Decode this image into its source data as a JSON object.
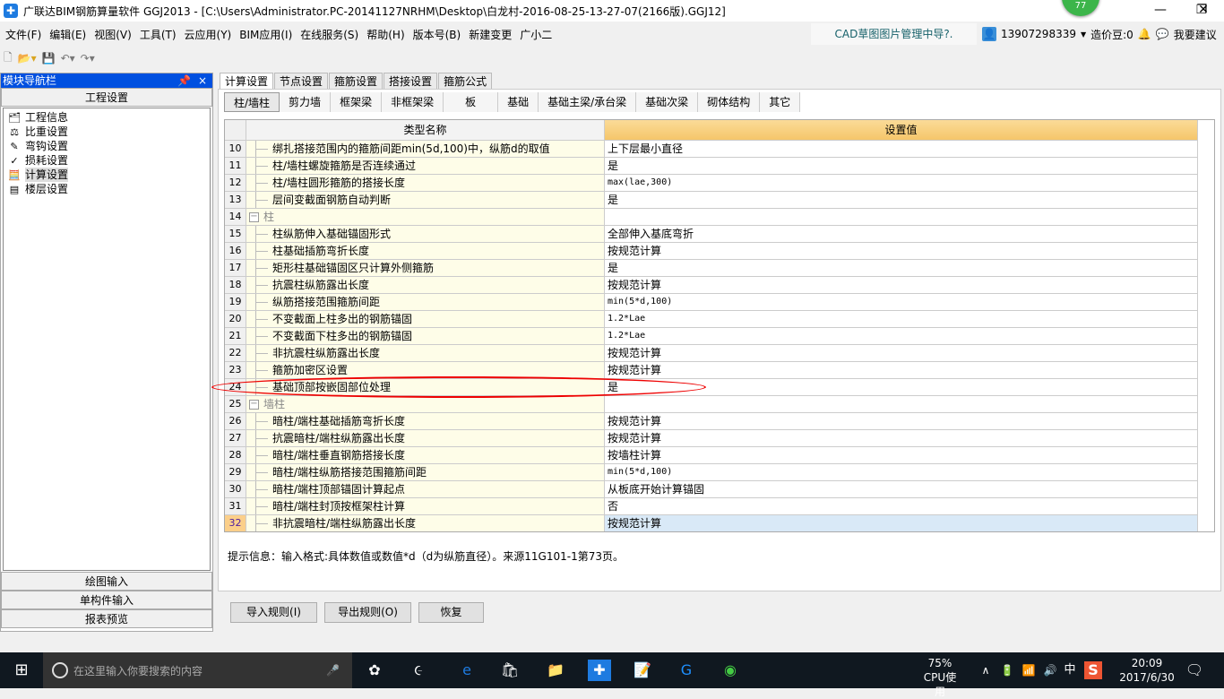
{
  "window": {
    "title": "广联达BIM钢筋算量软件 GGJ2013 - [C:\\Users\\Administrator.PC-20141127NRHM\\Desktop\\白龙村-2016-08-25-13-27-07(2166版).GGJ12]",
    "badge": "77"
  },
  "menu": [
    "文件(F)",
    "编辑(E)",
    "视图(V)",
    "工具(T)",
    "云应用(Y)",
    "BIM应用(I)",
    "在线服务(S)",
    "帮助(H)",
    "版本号(B)",
    "新建变更",
    "广小二"
  ],
  "cad_link": "CAD草图图片管理中导?.",
  "user": {
    "phone": "13907298339",
    "beans": "造价豆:0",
    "suggest": "我要建议"
  },
  "nav": {
    "title": "模块导航栏",
    "pin": "ᵖ",
    "close": "×",
    "section": "工程设置",
    "items": [
      {
        "label": "工程信息",
        "icon": "info-icon"
      },
      {
        "label": "比重设置",
        "icon": "weight-icon"
      },
      {
        "label": "弯钩设置",
        "icon": "hook-icon"
      },
      {
        "label": "损耗设置",
        "icon": "loss-icon"
      },
      {
        "label": "计算设置",
        "icon": "calc-icon",
        "selected": true
      },
      {
        "label": "楼层设置",
        "icon": "floor-icon"
      }
    ],
    "bottom": [
      "绘图输入",
      "单构件输入",
      "报表预览"
    ]
  },
  "tabs": [
    {
      "label": "计算设置",
      "active": true
    },
    {
      "label": "节点设置"
    },
    {
      "label": "箍筋设置"
    },
    {
      "label": "搭接设置"
    },
    {
      "label": "箍筋公式"
    }
  ],
  "subtabs": [
    {
      "label": "柱/墙柱",
      "active": true
    },
    {
      "label": "剪力墙"
    },
    {
      "label": "框架梁"
    },
    {
      "label": "非框架梁"
    },
    {
      "label": "板"
    },
    {
      "label": "基础"
    },
    {
      "label": "基础主梁/承台梁"
    },
    {
      "label": "基础次梁"
    },
    {
      "label": "砌体结构"
    },
    {
      "label": "其它"
    }
  ],
  "grid": {
    "headers": [
      "类型名称",
      "设置值"
    ],
    "header_accent": "#f5c66a",
    "selected_row": "32",
    "scroll_fraction": 0.45,
    "rows": [
      {
        "n": "10",
        "name": "绑扎搭接范围内的箍筋间距min(5d,100)中，纵筋d的取值",
        "value": "上下层最小直径"
      },
      {
        "n": "11",
        "name": "柱/墙柱螺旋箍筋是否连续通过",
        "value": "是"
      },
      {
        "n": "12",
        "name": "柱/墙柱圆形箍筋的搭接长度",
        "value": "max(lae,300)",
        "mono": true
      },
      {
        "n": "13",
        "name": "层间变截面钢筋自动判断",
        "value": "是"
      },
      {
        "n": "14",
        "name": "柱",
        "value": "",
        "group": true
      },
      {
        "n": "15",
        "name": "柱纵筋伸入基础锚固形式",
        "value": "全部伸入基底弯折"
      },
      {
        "n": "16",
        "name": "柱基础插筋弯折长度",
        "value": "按规范计算"
      },
      {
        "n": "17",
        "name": "矩形柱基础锚固区只计算外侧箍筋",
        "value": "是"
      },
      {
        "n": "18",
        "name": "抗震柱纵筋露出长度",
        "value": "按规范计算"
      },
      {
        "n": "19",
        "name": "纵筋搭接范围箍筋间距",
        "value": "min(5*d,100)",
        "mono": true
      },
      {
        "n": "20",
        "name": "不变截面上柱多出的钢筋锚固",
        "value": "1.2*Lae",
        "mono": true
      },
      {
        "n": "21",
        "name": "不变截面下柱多出的钢筋锚固",
        "value": "1.2*Lae",
        "mono": true
      },
      {
        "n": "22",
        "name": "非抗震柱纵筋露出长度",
        "value": "按规范计算"
      },
      {
        "n": "23",
        "name": "箍筋加密区设置",
        "value": "按规范计算"
      },
      {
        "n": "24",
        "name": "基础顶部按嵌固部位处理",
        "value": "是",
        "highlighted": true
      },
      {
        "n": "25",
        "name": "墙柱",
        "value": "",
        "group": true
      },
      {
        "n": "26",
        "name": "暗柱/端柱基础插筋弯折长度",
        "value": "按规范计算"
      },
      {
        "n": "27",
        "name": "抗震暗柱/端柱纵筋露出长度",
        "value": "按规范计算"
      },
      {
        "n": "28",
        "name": "暗柱/端柱垂直钢筋搭接长度",
        "value": "按墙柱计算"
      },
      {
        "n": "29",
        "name": "暗柱/端柱纵筋搭接范围箍筋间距",
        "value": "min(5*d,100)",
        "mono": true
      },
      {
        "n": "30",
        "name": "暗柱/端柱顶部锚固计算起点",
        "value": "从板底开始计算锚固"
      },
      {
        "n": "31",
        "name": "暗柱/端柱封顶按框架柱计算",
        "value": "否"
      },
      {
        "n": "32",
        "name": "非抗震暗柱/端柱纵筋露出长度",
        "value": "按规范计算"
      }
    ]
  },
  "hint": "提示信息：输入格式:具体数值或数值*d（d为纵筋直径）。来源11G101-1第73页。",
  "buttons": {
    "import": "导入规则(I)",
    "export": "导出规则(O)",
    "restore": "恢复"
  },
  "taskbar": {
    "search_placeholder": "在这里输入你要搜索的内容",
    "cpu": "75%",
    "cpu_label": "CPU使用",
    "ime": "中",
    "time": "20:09",
    "date": "2017/6/30"
  }
}
